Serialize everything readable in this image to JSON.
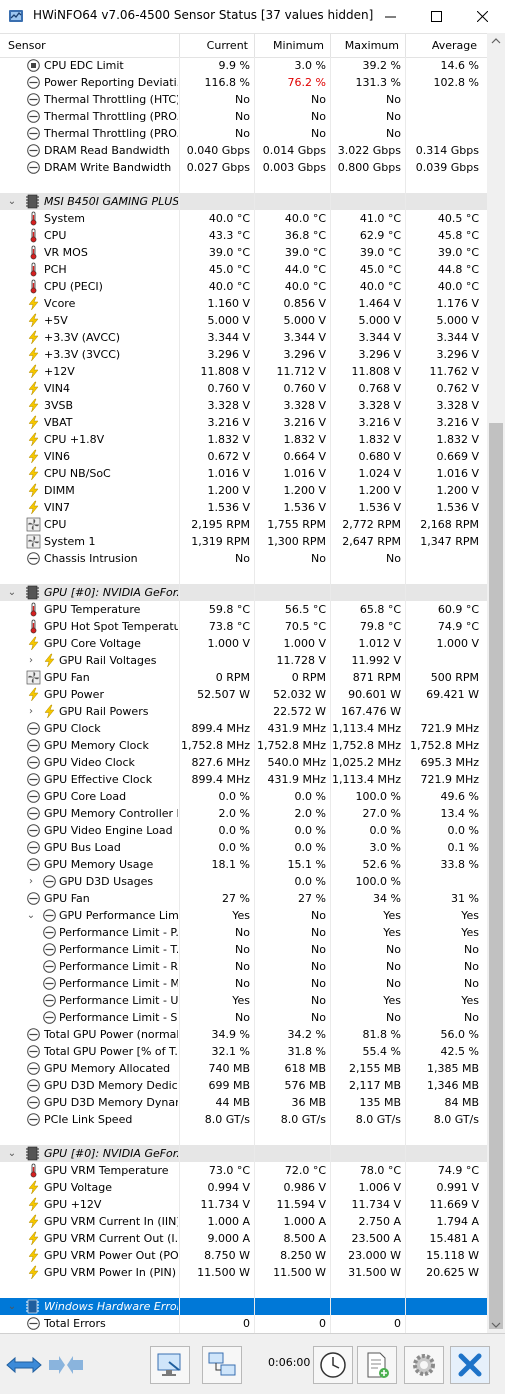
{
  "window": {
    "title": "HWiNFO64 v7.06-4500 Sensor Status [37 values hidden]"
  },
  "columns": {
    "sensor": "Sensor",
    "current": "Current",
    "minimum": "Minimum",
    "maximum": "Maximum",
    "average": "Average"
  },
  "rows": [
    {
      "type": "item",
      "icon": "cpu-chip-icon",
      "name": "CPU EDC Limit",
      "cur": "9.9 %",
      "min": "3.0 %",
      "max": "39.2 %",
      "avg": "14.6 %"
    },
    {
      "type": "item",
      "icon": "gauge-icon",
      "name": "Power Reporting Deviati...",
      "cur": "116.8 %",
      "min": "76.2 %",
      "max": "131.3 %",
      "avg": "102.8 %",
      "minRed": true
    },
    {
      "type": "item",
      "icon": "gauge-icon",
      "name": "Thermal Throttling (HTC)",
      "cur": "No",
      "min": "No",
      "max": "No",
      "avg": ""
    },
    {
      "type": "item",
      "icon": "gauge-icon",
      "name": "Thermal Throttling (PRO...",
      "cur": "No",
      "min": "No",
      "max": "No",
      "avg": ""
    },
    {
      "type": "item",
      "icon": "gauge-icon",
      "name": "Thermal Throttling (PRO...",
      "cur": "No",
      "min": "No",
      "max": "No",
      "avg": ""
    },
    {
      "type": "item",
      "icon": "gauge-icon",
      "name": "DRAM Read Bandwidth",
      "cur": "0.040 Gbps",
      "min": "0.014 Gbps",
      "max": "3.022 Gbps",
      "avg": "0.314 Gbps"
    },
    {
      "type": "item",
      "icon": "gauge-icon",
      "name": "DRAM Write Bandwidth",
      "cur": "0.027 Gbps",
      "min": "0.003 Gbps",
      "max": "0.800 Gbps",
      "avg": "0.039 Gbps"
    },
    {
      "type": "blank"
    },
    {
      "type": "group",
      "name": "MSI B450I GAMING PLUS..."
    },
    {
      "type": "item",
      "icon": "thermometer-icon",
      "name": "System",
      "cur": "40.0 °C",
      "min": "40.0 °C",
      "max": "41.0 °C",
      "avg": "40.5 °C"
    },
    {
      "type": "item",
      "icon": "thermometer-icon",
      "name": "CPU",
      "cur": "43.3 °C",
      "min": "36.8 °C",
      "max": "62.9 °C",
      "avg": "45.8 °C"
    },
    {
      "type": "item",
      "icon": "thermometer-icon",
      "name": "VR MOS",
      "cur": "39.0 °C",
      "min": "39.0 °C",
      "max": "39.0 °C",
      "avg": "39.0 °C"
    },
    {
      "type": "item",
      "icon": "thermometer-icon",
      "name": "PCH",
      "cur": "45.0 °C",
      "min": "44.0 °C",
      "max": "45.0 °C",
      "avg": "44.8 °C"
    },
    {
      "type": "item",
      "icon": "thermometer-icon",
      "name": "CPU (PECI)",
      "cur": "40.0 °C",
      "min": "40.0 °C",
      "max": "40.0 °C",
      "avg": "40.0 °C"
    },
    {
      "type": "item",
      "icon": "lightning-icon",
      "name": "Vcore",
      "cur": "1.160 V",
      "min": "0.856 V",
      "max": "1.464 V",
      "avg": "1.176 V"
    },
    {
      "type": "item",
      "icon": "lightning-icon",
      "name": "+5V",
      "cur": "5.000 V",
      "min": "5.000 V",
      "max": "5.000 V",
      "avg": "5.000 V"
    },
    {
      "type": "item",
      "icon": "lightning-icon",
      "name": "+3.3V (AVCC)",
      "cur": "3.344 V",
      "min": "3.344 V",
      "max": "3.344 V",
      "avg": "3.344 V"
    },
    {
      "type": "item",
      "icon": "lightning-icon",
      "name": "+3.3V (3VCC)",
      "cur": "3.296 V",
      "min": "3.296 V",
      "max": "3.296 V",
      "avg": "3.296 V"
    },
    {
      "type": "item",
      "icon": "lightning-icon",
      "name": "+12V",
      "cur": "11.808 V",
      "min": "11.712 V",
      "max": "11.808 V",
      "avg": "11.762 V"
    },
    {
      "type": "item",
      "icon": "lightning-icon",
      "name": "VIN4",
      "cur": "0.760 V",
      "min": "0.760 V",
      "max": "0.768 V",
      "avg": "0.762 V"
    },
    {
      "type": "item",
      "icon": "lightning-icon",
      "name": "3VSB",
      "cur": "3.328 V",
      "min": "3.328 V",
      "max": "3.328 V",
      "avg": "3.328 V"
    },
    {
      "type": "item",
      "icon": "lightning-icon",
      "name": "VBAT",
      "cur": "3.216 V",
      "min": "3.216 V",
      "max": "3.216 V",
      "avg": "3.216 V"
    },
    {
      "type": "item",
      "icon": "lightning-icon",
      "name": "CPU +1.8V",
      "cur": "1.832 V",
      "min": "1.832 V",
      "max": "1.832 V",
      "avg": "1.832 V"
    },
    {
      "type": "item",
      "icon": "lightning-icon",
      "name": "VIN6",
      "cur": "0.672 V",
      "min": "0.664 V",
      "max": "0.680 V",
      "avg": "0.669 V"
    },
    {
      "type": "item",
      "icon": "lightning-icon",
      "name": "CPU NB/SoC",
      "cur": "1.016 V",
      "min": "1.016 V",
      "max": "1.024 V",
      "avg": "1.016 V"
    },
    {
      "type": "item",
      "icon": "lightning-icon",
      "name": "DIMM",
      "cur": "1.200 V",
      "min": "1.200 V",
      "max": "1.200 V",
      "avg": "1.200 V"
    },
    {
      "type": "item",
      "icon": "lightning-icon",
      "name": "VIN7",
      "cur": "1.536 V",
      "min": "1.536 V",
      "max": "1.536 V",
      "avg": "1.536 V"
    },
    {
      "type": "item",
      "icon": "fan-icon",
      "name": "CPU",
      "cur": "2,195 RPM",
      "min": "1,755 RPM",
      "max": "2,772 RPM",
      "avg": "2,168 RPM"
    },
    {
      "type": "item",
      "icon": "fan-icon",
      "name": "System 1",
      "cur": "1,319 RPM",
      "min": "1,300 RPM",
      "max": "2,647 RPM",
      "avg": "1,347 RPM"
    },
    {
      "type": "item",
      "icon": "gauge-icon",
      "name": "Chassis Intrusion",
      "cur": "No",
      "min": "No",
      "max": "No",
      "avg": ""
    },
    {
      "type": "blank"
    },
    {
      "type": "group",
      "name": "GPU [#0]: NVIDIA GeFor..."
    },
    {
      "type": "item",
      "icon": "thermometer-icon",
      "name": "GPU Temperature",
      "cur": "59.8 °C",
      "min": "56.5 °C",
      "max": "65.8 °C",
      "avg": "60.9 °C"
    },
    {
      "type": "item",
      "icon": "thermometer-icon",
      "name": "GPU Hot Spot Temperature",
      "cur": "73.8 °C",
      "min": "70.5 °C",
      "max": "79.8 °C",
      "avg": "74.9 °C"
    },
    {
      "type": "item",
      "icon": "lightning-icon",
      "name": "GPU Core Voltage",
      "cur": "1.000 V",
      "min": "1.000 V",
      "max": "1.012 V",
      "avg": "1.000 V"
    },
    {
      "type": "sub",
      "icon": "lightning-icon",
      "name": "GPU Rail Voltages",
      "cur": "",
      "min": "11.728 V",
      "max": "11.992 V",
      "avg": "",
      "chev": "›"
    },
    {
      "type": "item",
      "icon": "fan-icon",
      "name": "GPU Fan",
      "cur": "0 RPM",
      "min": "0 RPM",
      "max": "871 RPM",
      "avg": "500 RPM"
    },
    {
      "type": "item",
      "icon": "lightning-icon",
      "name": "GPU Power",
      "cur": "52.507 W",
      "min": "52.032 W",
      "max": "90.601 W",
      "avg": "69.421 W"
    },
    {
      "type": "sub",
      "icon": "lightning-icon",
      "name": "GPU Rail Powers",
      "cur": "",
      "min": "22.572 W",
      "max": "167.476 W",
      "avg": "",
      "chev": "›"
    },
    {
      "type": "item",
      "icon": "gauge-icon",
      "name": "GPU Clock",
      "cur": "899.4 MHz",
      "min": "431.9 MHz",
      "max": "1,113.4 MHz",
      "avg": "721.9 MHz"
    },
    {
      "type": "item",
      "icon": "gauge-icon",
      "name": "GPU Memory Clock",
      "cur": "1,752.8 MHz",
      "min": "1,752.8 MHz",
      "max": "1,752.8 MHz",
      "avg": "1,752.8 MHz"
    },
    {
      "type": "item",
      "icon": "gauge-icon",
      "name": "GPU Video Clock",
      "cur": "827.6 MHz",
      "min": "540.0 MHz",
      "max": "1,025.2 MHz",
      "avg": "695.3 MHz"
    },
    {
      "type": "item",
      "icon": "gauge-icon",
      "name": "GPU Effective Clock",
      "cur": "899.4 MHz",
      "min": "431.9 MHz",
      "max": "1,113.4 MHz",
      "avg": "721.9 MHz"
    },
    {
      "type": "item",
      "icon": "gauge-icon",
      "name": "GPU Core Load",
      "cur": "0.0 %",
      "min": "0.0 %",
      "max": "100.0 %",
      "avg": "49.6 %"
    },
    {
      "type": "item",
      "icon": "gauge-icon",
      "name": "GPU Memory Controller L...",
      "cur": "2.0 %",
      "min": "2.0 %",
      "max": "27.0 %",
      "avg": "13.4 %"
    },
    {
      "type": "item",
      "icon": "gauge-icon",
      "name": "GPU Video Engine Load",
      "cur": "0.0 %",
      "min": "0.0 %",
      "max": "0.0 %",
      "avg": "0.0 %"
    },
    {
      "type": "item",
      "icon": "gauge-icon",
      "name": "GPU Bus Load",
      "cur": "0.0 %",
      "min": "0.0 %",
      "max": "3.0 %",
      "avg": "0.1 %"
    },
    {
      "type": "item",
      "icon": "gauge-icon",
      "name": "GPU Memory Usage",
      "cur": "18.1 %",
      "min": "15.1 %",
      "max": "52.6 %",
      "avg": "33.8 %"
    },
    {
      "type": "sub",
      "icon": "gauge-icon",
      "name": "GPU D3D Usages",
      "cur": "",
      "min": "0.0 %",
      "max": "100.0 %",
      "avg": "",
      "chev": "›"
    },
    {
      "type": "item",
      "icon": "gauge-icon",
      "name": "GPU Fan",
      "cur": "27 %",
      "min": "27 %",
      "max": "34 %",
      "avg": "31 %"
    },
    {
      "type": "sub",
      "icon": "gauge-icon",
      "name": "GPU Performance Limits",
      "cur": "Yes",
      "min": "No",
      "max": "Yes",
      "avg": "Yes",
      "chev": "⌄"
    },
    {
      "type": "sub2",
      "icon": "gauge-icon",
      "name": "Performance Limit - P...",
      "cur": "No",
      "min": "No",
      "max": "Yes",
      "avg": "Yes"
    },
    {
      "type": "sub2",
      "icon": "gauge-icon",
      "name": "Performance Limit - T...",
      "cur": "No",
      "min": "No",
      "max": "No",
      "avg": "No"
    },
    {
      "type": "sub2",
      "icon": "gauge-icon",
      "name": "Performance Limit - R...",
      "cur": "No",
      "min": "No",
      "max": "No",
      "avg": "No"
    },
    {
      "type": "sub2",
      "icon": "gauge-icon",
      "name": "Performance Limit - M...",
      "cur": "No",
      "min": "No",
      "max": "No",
      "avg": "No"
    },
    {
      "type": "sub2",
      "icon": "gauge-icon",
      "name": "Performance Limit - U...",
      "cur": "Yes",
      "min": "No",
      "max": "Yes",
      "avg": "Yes"
    },
    {
      "type": "sub2",
      "icon": "gauge-icon",
      "name": "Performance Limit - S...",
      "cur": "No",
      "min": "No",
      "max": "No",
      "avg": "No"
    },
    {
      "type": "item",
      "icon": "gauge-icon",
      "name": "Total GPU Power (normali...",
      "cur": "34.9 %",
      "min": "34.2 %",
      "max": "81.8 %",
      "avg": "56.0 %"
    },
    {
      "type": "item",
      "icon": "gauge-icon",
      "name": "Total GPU Power [% of T...",
      "cur": "32.1 %",
      "min": "31.8 %",
      "max": "55.4 %",
      "avg": "42.5 %"
    },
    {
      "type": "item",
      "icon": "gauge-icon",
      "name": "GPU Memory Allocated",
      "cur": "740 MB",
      "min": "618 MB",
      "max": "2,155 MB",
      "avg": "1,385 MB"
    },
    {
      "type": "item",
      "icon": "gauge-icon",
      "name": "GPU D3D Memory Dedica...",
      "cur": "699 MB",
      "min": "576 MB",
      "max": "2,117 MB",
      "avg": "1,346 MB"
    },
    {
      "type": "item",
      "icon": "gauge-icon",
      "name": "GPU D3D Memory Dynamic",
      "cur": "44 MB",
      "min": "36 MB",
      "max": "135 MB",
      "avg": "84 MB"
    },
    {
      "type": "item",
      "icon": "gauge-icon",
      "name": "PCIe Link Speed",
      "cur": "8.0 GT/s",
      "min": "8.0 GT/s",
      "max": "8.0 GT/s",
      "avg": "8.0 GT/s"
    },
    {
      "type": "blank"
    },
    {
      "type": "group",
      "name": "GPU [#0]: NVIDIA GeFor..."
    },
    {
      "type": "item",
      "icon": "thermometer-icon",
      "name": "GPU VRM Temperature",
      "cur": "73.0 °C",
      "min": "72.0 °C",
      "max": "78.0 °C",
      "avg": "74.9 °C"
    },
    {
      "type": "item",
      "icon": "lightning-icon",
      "name": "GPU Voltage",
      "cur": "0.994 V",
      "min": "0.986 V",
      "max": "1.006 V",
      "avg": "0.991 V"
    },
    {
      "type": "item",
      "icon": "lightning-icon",
      "name": "GPU +12V",
      "cur": "11.734 V",
      "min": "11.594 V",
      "max": "11.734 V",
      "avg": "11.669 V"
    },
    {
      "type": "item",
      "icon": "lightning-icon",
      "name": "GPU VRM Current In (IIN)",
      "cur": "1.000 A",
      "min": "1.000 A",
      "max": "2.750 A",
      "avg": "1.794 A"
    },
    {
      "type": "item",
      "icon": "lightning-icon",
      "name": "GPU VRM Current Out (I...",
      "cur": "9.000 A",
      "min": "8.500 A",
      "max": "23.500 A",
      "avg": "15.481 A"
    },
    {
      "type": "item",
      "icon": "lightning-icon",
      "name": "GPU VRM Power Out (PO...",
      "cur": "8.750 W",
      "min": "8.250 W",
      "max": "23.000 W",
      "avg": "15.118 W"
    },
    {
      "type": "item",
      "icon": "lightning-icon",
      "name": "GPU VRM Power In (PIN)",
      "cur": "11.500 W",
      "min": "11.500 W",
      "max": "31.500 W",
      "avg": "20.625 W"
    },
    {
      "type": "blank"
    },
    {
      "type": "group",
      "name": "Windows Hardware Error...",
      "selected": true
    },
    {
      "type": "item",
      "icon": "gauge-icon",
      "name": "Total Errors",
      "cur": "0",
      "min": "0",
      "max": "0",
      "avg": ""
    }
  ],
  "footer": {
    "timer": "0:06:00"
  },
  "colors": {
    "selection": "#0078d7",
    "accent_red": "#e00000",
    "close_blue": "#1e73c8"
  }
}
